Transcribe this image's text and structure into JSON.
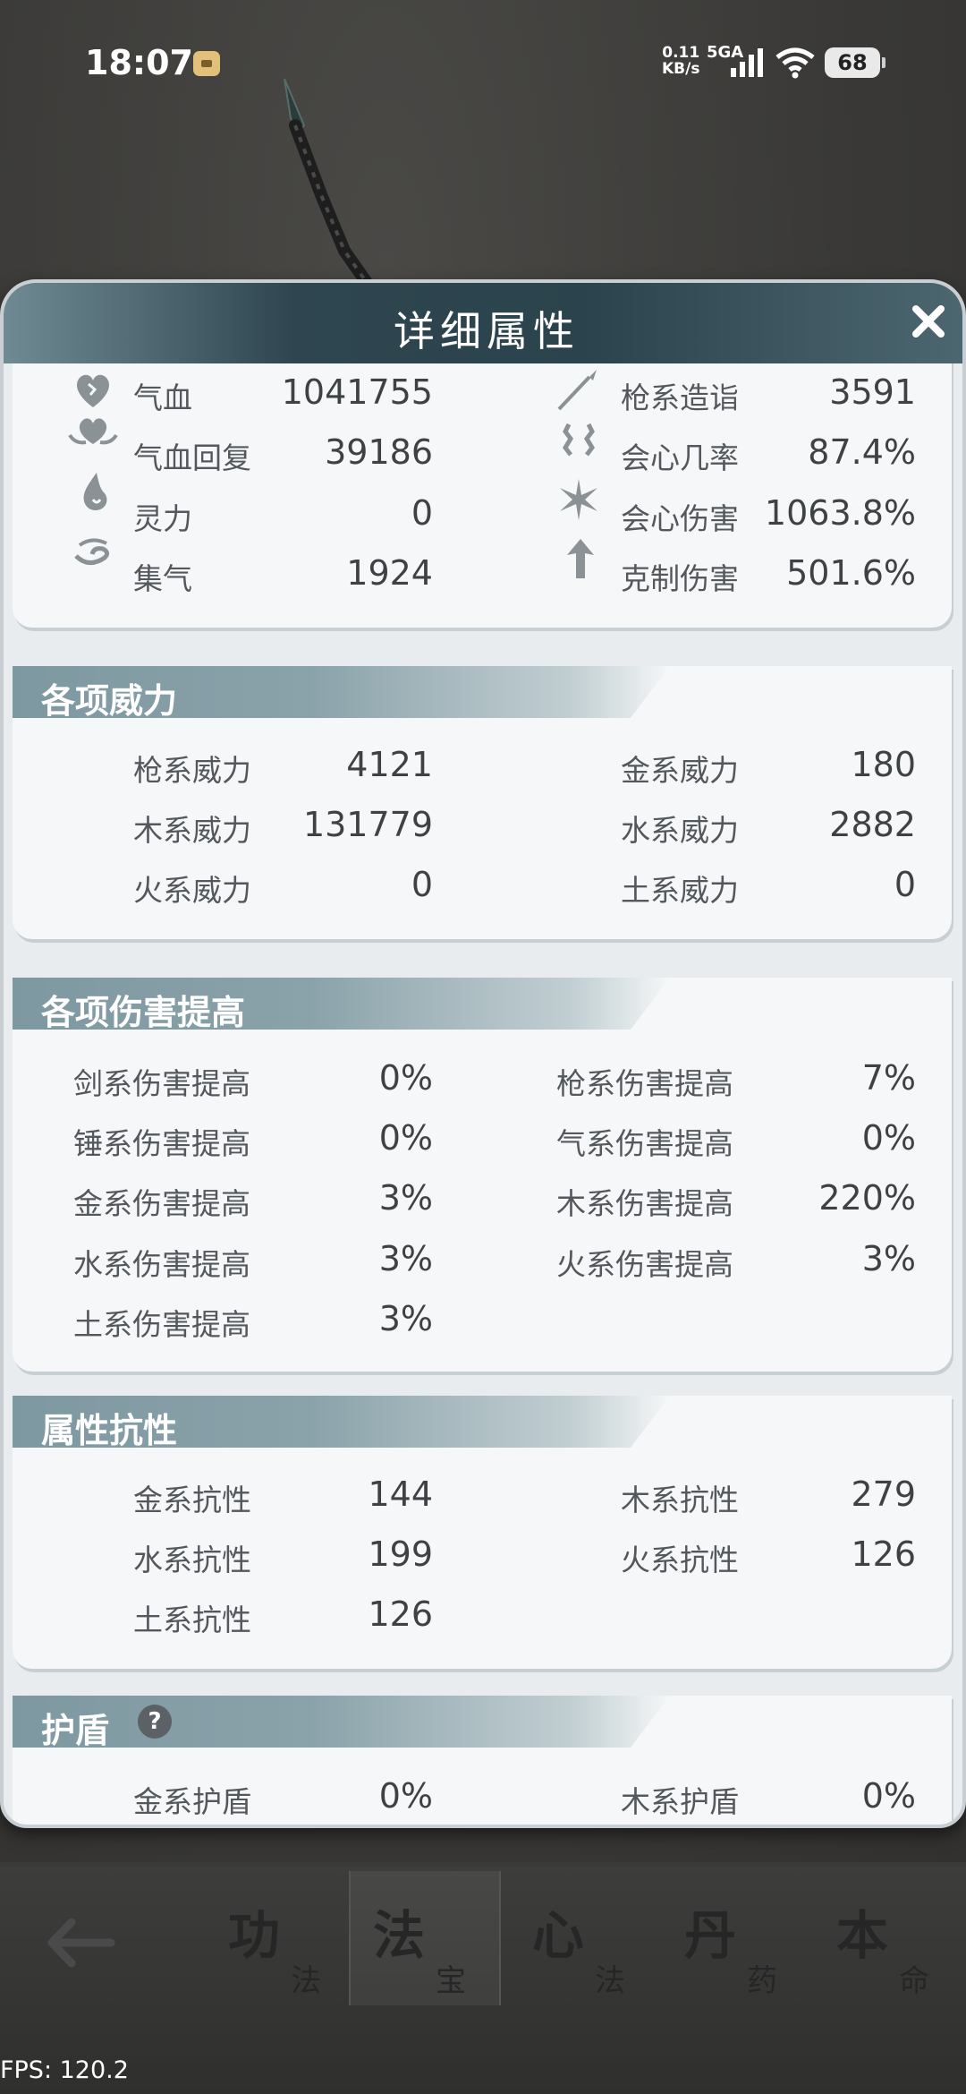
{
  "status_bar": {
    "time": "18:07",
    "net_speed_value": "0.11",
    "net_speed_unit": "KB/s",
    "network": "5GA",
    "battery": "68"
  },
  "panel": {
    "title": "详细属性",
    "close_label": "X"
  },
  "basic_stats": {
    "left": [
      {
        "label": "气血",
        "value": "1041755",
        "icon": "heart-icon"
      },
      {
        "label": "气血回复",
        "value": "39186",
        "icon": "heal-icon"
      },
      {
        "label": "灵力",
        "value": "0",
        "icon": "spirit-drop-icon"
      },
      {
        "label": "集气",
        "value": "1924",
        "icon": "swirl-icon"
      }
    ],
    "right": [
      {
        "label": "枪系造诣",
        "value": "3591",
        "icon": "spear-icon"
      },
      {
        "label": "会心几率",
        "value": "87.4%",
        "icon": "crit-rate-icon"
      },
      {
        "label": "会心伤害",
        "value": "1063.8%",
        "icon": "crit-damage-icon"
      },
      {
        "label": "克制伤害",
        "value": "501.6%",
        "icon": "counter-arrow-icon"
      }
    ]
  },
  "power": {
    "title": "各项威力",
    "left": [
      {
        "label": "枪系威力",
        "value": "4121"
      },
      {
        "label": "木系威力",
        "value": "131779"
      },
      {
        "label": "火系威力",
        "value": "0"
      }
    ],
    "right": [
      {
        "label": "金系威力",
        "value": "180"
      },
      {
        "label": "水系威力",
        "value": "2882"
      },
      {
        "label": "土系威力",
        "value": "0"
      }
    ]
  },
  "damage_boost": {
    "title": "各项伤害提高",
    "left": [
      {
        "label": "剑系伤害提高",
        "value": "0%"
      },
      {
        "label": "锤系伤害提高",
        "value": "0%"
      },
      {
        "label": "金系伤害提高",
        "value": "3%"
      },
      {
        "label": "水系伤害提高",
        "value": "3%"
      },
      {
        "label": "土系伤害提高",
        "value": "3%"
      }
    ],
    "right": [
      {
        "label": "枪系伤害提高",
        "value": "7%"
      },
      {
        "label": "气系伤害提高",
        "value": "0%"
      },
      {
        "label": "木系伤害提高",
        "value": "220%"
      },
      {
        "label": "火系伤害提高",
        "value": "3%"
      }
    ]
  },
  "resistance": {
    "title": "属性抗性",
    "left": [
      {
        "label": "金系抗性",
        "value": "144"
      },
      {
        "label": "水系抗性",
        "value": "199"
      },
      {
        "label": "土系抗性",
        "value": "126"
      }
    ],
    "right": [
      {
        "label": "木系抗性",
        "value": "279"
      },
      {
        "label": "火系抗性",
        "value": "126"
      }
    ]
  },
  "shield": {
    "title": "护盾",
    "help": "?",
    "left": [
      {
        "label": "金系护盾",
        "value": "0%"
      }
    ],
    "right": [
      {
        "label": "木系护盾",
        "value": "0%"
      }
    ]
  },
  "bottom_nav": {
    "tabs": [
      {
        "big": "功",
        "small": "法"
      },
      {
        "big": "法",
        "small": "宝"
      },
      {
        "big": "心",
        "small": "法"
      },
      {
        "big": "丹",
        "small": "药"
      },
      {
        "big": "本",
        "small": "命"
      }
    ]
  },
  "fps": "FPS: 120.2"
}
